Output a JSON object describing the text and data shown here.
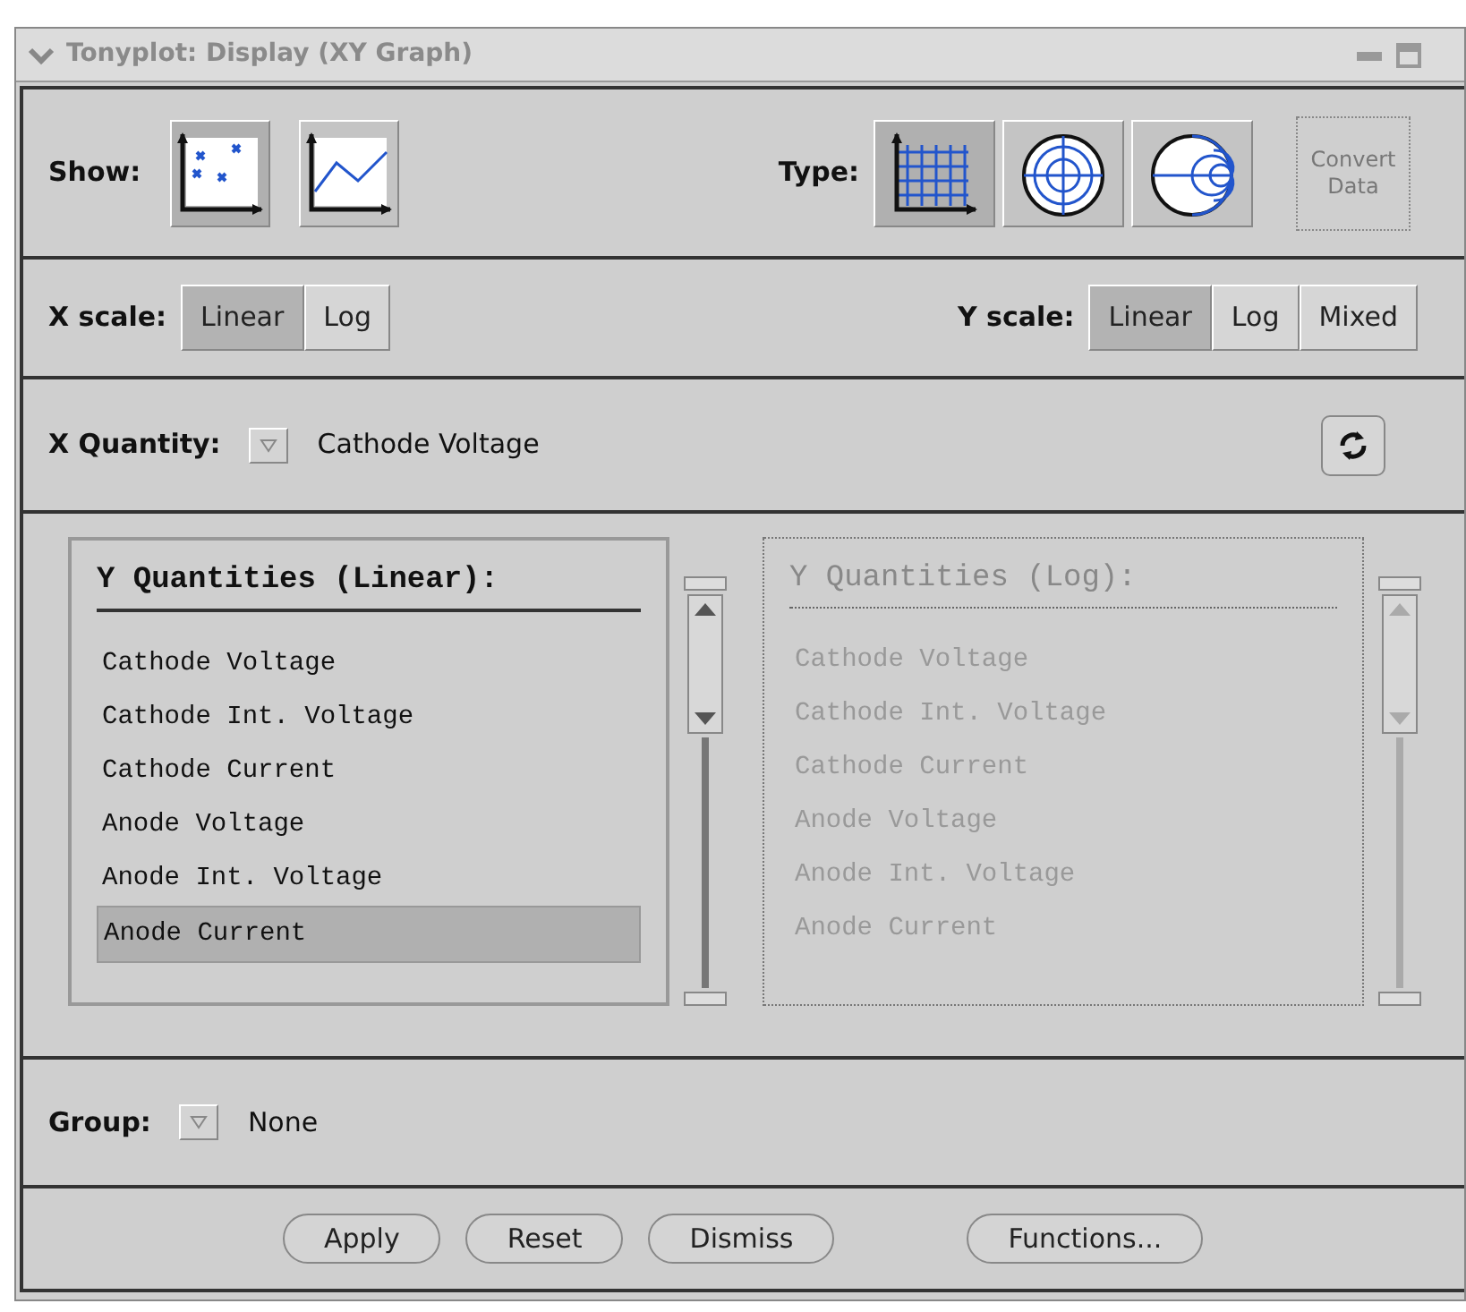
{
  "window": {
    "title": "Tonyplot: Display (XY Graph)"
  },
  "show": {
    "label": "Show:",
    "options": [
      {
        "kind": "scatter",
        "selected": true
      },
      {
        "kind": "line",
        "selected": false
      }
    ]
  },
  "type": {
    "label": "Type:",
    "options": [
      {
        "kind": "cartesian",
        "selected": true
      },
      {
        "kind": "polar",
        "selected": false
      },
      {
        "kind": "smith",
        "selected": false
      }
    ]
  },
  "convert_button": {
    "label": "Convert Data",
    "disabled": true
  },
  "x_scale": {
    "label": "X scale:",
    "options": [
      {
        "label": "Linear",
        "selected": true
      },
      {
        "label": "Log",
        "selected": false
      }
    ]
  },
  "y_scale": {
    "label": "Y scale:",
    "options": [
      {
        "label": "Linear",
        "selected": true
      },
      {
        "label": "Log",
        "selected": false
      },
      {
        "label": "Mixed",
        "selected": false
      }
    ]
  },
  "x_quantity": {
    "label": "X Quantity:",
    "value": "Cathode Voltage"
  },
  "y_lists": [
    {
      "title": "Y Quantities (Linear):",
      "disabled": false,
      "items": [
        {
          "label": "Cathode Voltage",
          "selected": false
        },
        {
          "label": "Cathode Int. Voltage",
          "selected": false
        },
        {
          "label": "Cathode Current",
          "selected": false
        },
        {
          "label": "Anode Voltage",
          "selected": false
        },
        {
          "label": "Anode Int. Voltage",
          "selected": false
        },
        {
          "label": "Anode Current",
          "selected": true
        }
      ]
    },
    {
      "title": "Y Quantities (Log):",
      "disabled": true,
      "items": [
        {
          "label": "Cathode Voltage",
          "selected": false
        },
        {
          "label": "Cathode Int. Voltage",
          "selected": false
        },
        {
          "label": "Cathode Current",
          "selected": false
        },
        {
          "label": "Anode Voltage",
          "selected": false
        },
        {
          "label": "Anode Int. Voltage",
          "selected": false
        },
        {
          "label": "Anode Current",
          "selected": false
        }
      ]
    }
  ],
  "group": {
    "label": "Group:",
    "value": "None"
  },
  "buttons": [
    "Apply",
    "Reset",
    "Dismiss",
    "Functions..."
  ]
}
